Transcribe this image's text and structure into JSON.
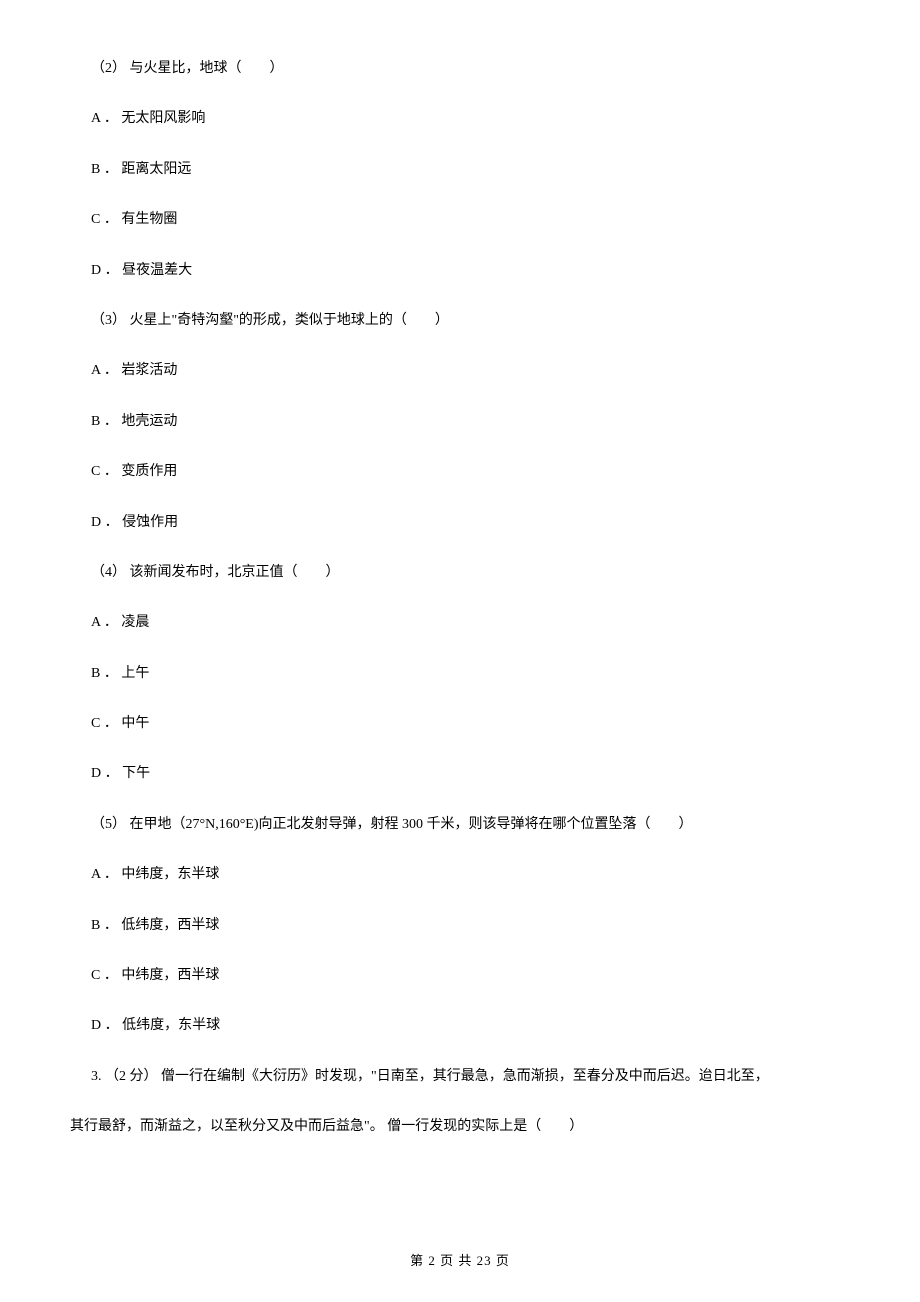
{
  "q2_sub2": {
    "text": "（2） 与火星比，地球（　　）",
    "options": {
      "a": "A ．  无太阳风影响",
      "b": "B ．  距离太阳远",
      "c": "C ．  有生物圈",
      "d": "D ．  昼夜温差大"
    }
  },
  "q2_sub3": {
    "text": "（3） 火星上\"奇特沟壑\"的形成，类似于地球上的（　　）",
    "options": {
      "a": "A ．  岩浆活动",
      "b": "B ．  地壳运动",
      "c": "C ．  变质作用",
      "d": "D ．  侵蚀作用"
    }
  },
  "q2_sub4": {
    "text": "（4） 该新闻发布时，北京正值（　　）",
    "options": {
      "a": "A ．  凌晨",
      "b": "B ．  上午",
      "c": "C ．  中午",
      "d": "D ．  下午"
    }
  },
  "q2_sub5": {
    "text": "（5） 在甲地（27°N,160°E)向正北发射导弹，射程 300 千米，则该导弹将在哪个位置坠落（　　）",
    "options": {
      "a": "A ．  中纬度，东半球",
      "b": "B ．  低纬度，西半球",
      "c": "C ．  中纬度，西半球",
      "d": "D ．  低纬度，东半球"
    }
  },
  "q3": {
    "line1": "3. （2 分） 僧一行在编制《大衍历》时发现，\"日南至，其行最急，急而渐损，至春分及中而后迟。迨日北至，",
    "line2": "其行最舒，而渐益之，以至秋分又及中而后益急\"。 僧一行发现的实际上是（　　）"
  },
  "footer": "第 2 页 共 23 页"
}
